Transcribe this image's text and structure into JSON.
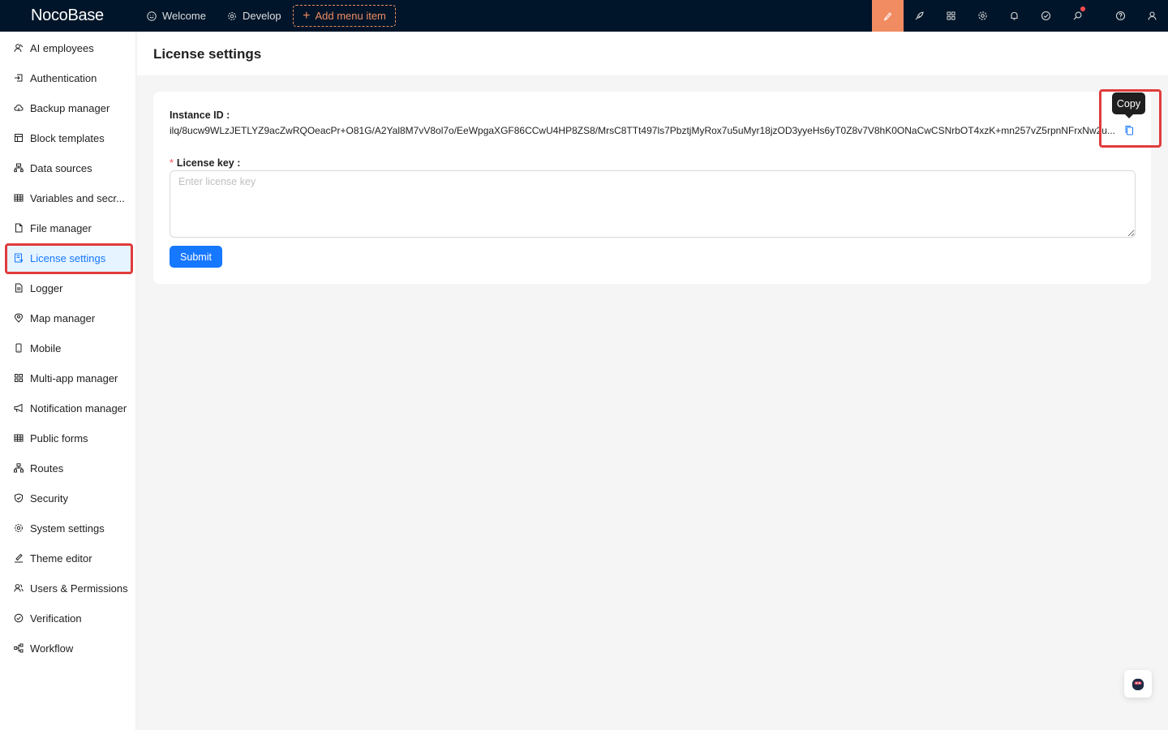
{
  "app": {
    "logo": "NocoBase"
  },
  "topnav": {
    "items": [
      {
        "label": "Welcome",
        "icon": "smile-icon"
      },
      {
        "label": "Develop",
        "icon": "gear-icon"
      }
    ],
    "add_menu_label": "Add menu item"
  },
  "toolbar_icons": [
    "theme-brush-icon",
    "rocket-icon",
    "apps-icon",
    "settings-icon",
    "bell-icon",
    "check-circle-icon",
    "search-icon",
    "help-icon",
    "user-icon"
  ],
  "sidebar": {
    "active": "License settings",
    "items": [
      {
        "label": "AI employees",
        "icon": "ai-icon"
      },
      {
        "label": "Authentication",
        "icon": "login-icon"
      },
      {
        "label": "Backup manager",
        "icon": "cloud-icon"
      },
      {
        "label": "Block templates",
        "icon": "layout-icon"
      },
      {
        "label": "Data sources",
        "icon": "database-icon"
      },
      {
        "label": "Variables and secr...",
        "icon": "table-icon"
      },
      {
        "label": "File manager",
        "icon": "file-icon"
      },
      {
        "label": "License settings",
        "icon": "license-icon"
      },
      {
        "label": "Logger",
        "icon": "file-text-icon"
      },
      {
        "label": "Map manager",
        "icon": "location-icon"
      },
      {
        "label": "Mobile",
        "icon": "mobile-icon"
      },
      {
        "label": "Multi-app manager",
        "icon": "appstore-icon"
      },
      {
        "label": "Notification manager",
        "icon": "notification-icon"
      },
      {
        "label": "Public forms",
        "icon": "table-icon"
      },
      {
        "label": "Routes",
        "icon": "routes-icon"
      },
      {
        "label": "Security",
        "icon": "shield-icon"
      },
      {
        "label": "System settings",
        "icon": "settings-icon"
      },
      {
        "label": "Theme editor",
        "icon": "brush-icon"
      },
      {
        "label": "Users & Permissions",
        "icon": "users-icon"
      },
      {
        "label": "Verification",
        "icon": "check-circle-icon"
      },
      {
        "label": "Workflow",
        "icon": "workflow-icon"
      }
    ]
  },
  "page": {
    "title": "License settings",
    "instance_label": "Instance ID",
    "instance_value": "ilq/8ucw9WLzJETLYZ9acZwRQOeacPr+O81G/A2Yal8M7vV8ol7o/EeWpgaXGF86CCwU4HP8ZS8/MrsC8TTt497ls7PbztjMyRox7u5uMyr18jzOD3yyeHs6yT0Z8v7V8hK0ONaCwCSNrbOT4xzK+mn257vZ5rpnNFrxNw2u...",
    "license_label": "License key",
    "license_placeholder": "Enter license key",
    "submit_label": "Submit",
    "tooltip": "Copy"
  },
  "colors": {
    "topbar": "#001529",
    "accent": "#f18b62",
    "primary": "#1677ff",
    "highlight": "#e03c3c"
  }
}
